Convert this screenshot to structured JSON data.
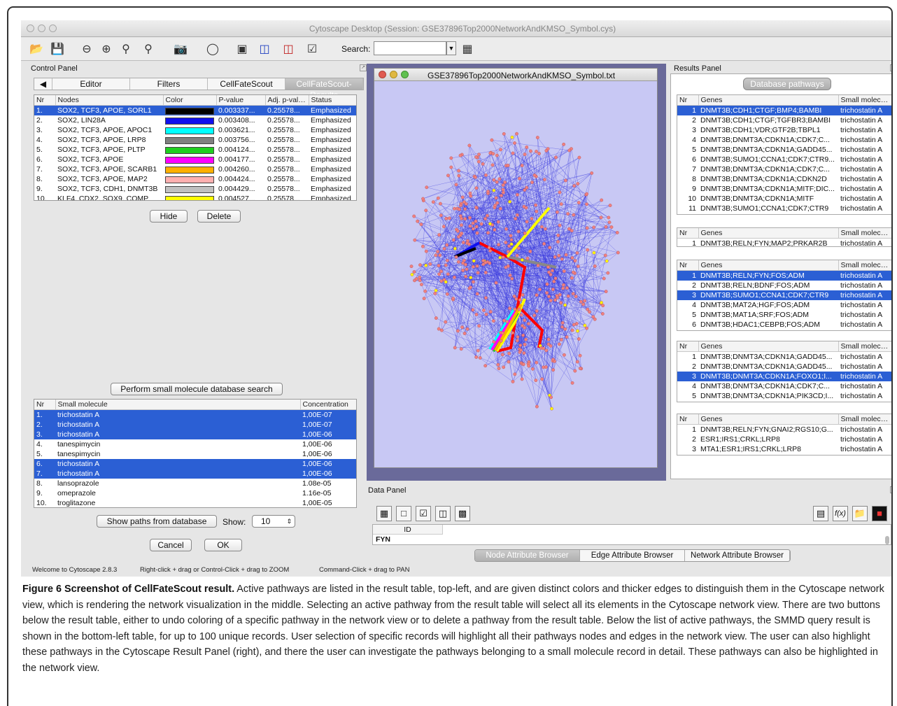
{
  "window": {
    "title": "Cytoscape Desktop (Session: GSE37896Top2000NetworkAndKMSO_Symbol.cys)"
  },
  "toolbar": {
    "search_label": "Search:",
    "search_value": ""
  },
  "control_panel": {
    "title": "Control Panel",
    "tabs": [
      "Editor",
      "Filters",
      "CellFateScout",
      "CellFateScout-Results"
    ],
    "active_tab": "CellFateScout-Results",
    "pathways_table": {
      "columns": [
        "Nr",
        "Nodes",
        "Color",
        "P-value",
        "Adj. p-value",
        "Status"
      ],
      "rows": [
        {
          "nr": "1.",
          "nodes": "SOX2, TCF3, APOE, SORL1",
          "color": "#000000",
          "p": "0.003337...",
          "adj": "0.25578...",
          "status": "Emphasized",
          "selected": true
        },
        {
          "nr": "2.",
          "nodes": "SOX2, LIN28A",
          "color": "#1010ee",
          "p": "0.003408...",
          "adj": "0.25578...",
          "status": "Emphasized",
          "selected": false
        },
        {
          "nr": "3.",
          "nodes": "SOX2, TCF3, APOE, APOC1",
          "color": "#00ffff",
          "p": "0.003621...",
          "adj": "0.25578...",
          "status": "Emphasized",
          "selected": false
        },
        {
          "nr": "4.",
          "nodes": "SOX2, TCF3, APOE, LRP8",
          "color": "#808080",
          "p": "0.003756...",
          "adj": "0.25578...",
          "status": "Emphasized",
          "selected": false
        },
        {
          "nr": "5.",
          "nodes": "SOX2, TCF3, APOE, PLTP",
          "color": "#1fcf1f",
          "p": "0.004124...",
          "adj": "0.25578...",
          "status": "Emphasized",
          "selected": false
        },
        {
          "nr": "6.",
          "nodes": "SOX2, TCF3, APOE",
          "color": "#ff00ff",
          "p": "0.004177...",
          "adj": "0.25578...",
          "status": "Emphasized",
          "selected": false
        },
        {
          "nr": "7.",
          "nodes": "SOX2, TCF3, APOE, SCARB1",
          "color": "#ffb000",
          "p": "0.004260...",
          "adj": "0.25578...",
          "status": "Emphasized",
          "selected": false
        },
        {
          "nr": "8.",
          "nodes": "SOX2, TCF3, APOE, MAP2",
          "color": "#ffb0b0",
          "p": "0.004424...",
          "adj": "0.25578...",
          "status": "Emphasized",
          "selected": false
        },
        {
          "nr": "9.",
          "nodes": "SOX2, TCF3, CDH1, DNMT3B",
          "color": "#c0c0c0",
          "p": "0.004429...",
          "adj": "0.25578...",
          "status": "Emphasized",
          "selected": false
        },
        {
          "nr": "10.",
          "nodes": "KLF4, CDX2, SOX9, COMP",
          "color": "#ffff00",
          "p": "0.004527...",
          "adj": "0.25578...",
          "status": "Emphasized",
          "selected": false
        }
      ]
    },
    "hide_label": "Hide",
    "delete_label": "Delete",
    "search_button": "Perform small molecule database search",
    "molecule_table": {
      "columns": [
        "Nr",
        "Small molecule",
        "Concentration"
      ],
      "rows": [
        {
          "nr": "1.",
          "name": "trichostatin A",
          "conc": "1,00E-07",
          "selected": true
        },
        {
          "nr": "2.",
          "name": "trichostatin A",
          "conc": "1,00E-07",
          "selected": true
        },
        {
          "nr": "3.",
          "name": "trichostatin A",
          "conc": "1,00E-06",
          "selected": true
        },
        {
          "nr": "4.",
          "name": "tanespimycin",
          "conc": "1,00E-06",
          "selected": false
        },
        {
          "nr": "5.",
          "name": "tanespimycin",
          "conc": "1,00E-06",
          "selected": false
        },
        {
          "nr": "6.",
          "name": "trichostatin A",
          "conc": "1,00E-06",
          "selected": true
        },
        {
          "nr": "7.",
          "name": "trichostatin A",
          "conc": "1,00E-06",
          "selected": true
        },
        {
          "nr": "8.",
          "name": "lansoprazole",
          "conc": "1.08e-05",
          "selected": false
        },
        {
          "nr": "9.",
          "name": "omeprazole",
          "conc": "1.16e-05",
          "selected": false
        },
        {
          "nr": "10.",
          "name": "troglitazone",
          "conc": "1,00E-05",
          "selected": false
        }
      ]
    },
    "show_paths_label": "Show paths from database",
    "show_label": "Show:",
    "show_value": "10",
    "cancel_label": "Cancel",
    "ok_label": "OK"
  },
  "network_window": {
    "title": "GSE37896Top2000NetworkAndKMSO_Symbol.txt"
  },
  "results_panel": {
    "title": "Results Panel",
    "db_button": "Database pathways",
    "col_nr": "Nr",
    "col_genes": "Genes",
    "col_small": "Small molecule",
    "groups": [
      {
        "rows": [
          {
            "nr": "1",
            "genes": "DNMT3B;CDH1;CTGF;BMP4;BAMBI",
            "mol": "trichostatin A",
            "selected": true
          },
          {
            "nr": "2",
            "genes": "DNMT3B;CDH1;CTGF;TGFBR3;BAMBI",
            "mol": "trichostatin A",
            "selected": false
          },
          {
            "nr": "3",
            "genes": "DNMT3B;CDH1;VDR;GTF2B;TBPL1",
            "mol": "trichostatin A",
            "selected": false
          },
          {
            "nr": "4",
            "genes": "DNMT3B;DNMT3A;CDKN1A;CDK7;C...",
            "mol": "trichostatin A",
            "selected": false
          },
          {
            "nr": "5",
            "genes": "DNMT3B;DNMT3A;CDKN1A;GADD45...",
            "mol": "trichostatin A",
            "selected": false
          },
          {
            "nr": "6",
            "genes": "DNMT3B;SUMO1;CCNA1;CDK7;CTR9...",
            "mol": "trichostatin A",
            "selected": false
          },
          {
            "nr": "7",
            "genes": "DNMT3B;DNMT3A;CDKN1A;CDK7;C...",
            "mol": "trichostatin A",
            "selected": false
          },
          {
            "nr": "8",
            "genes": "DNMT3B;DNMT3A;CDKN1A;CDKN2D",
            "mol": "trichostatin A",
            "selected": false
          },
          {
            "nr": "9",
            "genes": "DNMT3B;DNMT3A;CDKN1A;MITF;DIC...",
            "mol": "trichostatin A",
            "selected": false
          },
          {
            "nr": "10",
            "genes": "DNMT3B;DNMT3A;CDKN1A;MITF",
            "mol": "trichostatin A",
            "selected": false
          },
          {
            "nr": "11",
            "genes": "DNMT3B;SUMO1;CCNA1;CDK7;CTR9",
            "mol": "trichostatin A",
            "selected": false
          }
        ]
      },
      {
        "rows": [
          {
            "nr": "1",
            "genes": "DNMT3B;RELN;FYN;MAP2;PRKAR2B",
            "mol": "trichostatin A",
            "selected": false
          }
        ]
      },
      {
        "rows": [
          {
            "nr": "1",
            "genes": "DNMT3B;RELN;FYN;FOS;ADM",
            "mol": "trichostatin A",
            "selected": true
          },
          {
            "nr": "2",
            "genes": "DNMT3B;RELN;BDNF;FOS;ADM",
            "mol": "trichostatin A",
            "selected": false
          },
          {
            "nr": "3",
            "genes": "DNMT3B;SUMO1;CCNA1;CDK7;CTR9",
            "mol": "trichostatin A",
            "selected": true
          },
          {
            "nr": "4",
            "genes": "DNMT3B;MAT2A;HGF;FOS;ADM",
            "mol": "trichostatin A",
            "selected": false
          },
          {
            "nr": "5",
            "genes": "DNMT3B;MAT1A;SRF;FOS;ADM",
            "mol": "trichostatin A",
            "selected": false
          },
          {
            "nr": "6",
            "genes": "DNMT3B;HDAC1;CEBPB;FOS;ADM",
            "mol": "trichostatin A",
            "selected": false
          }
        ]
      },
      {
        "rows": [
          {
            "nr": "1",
            "genes": "DNMT3B;DNMT3A;CDKN1A;GADD45...",
            "mol": "trichostatin A",
            "selected": false
          },
          {
            "nr": "2",
            "genes": "DNMT3B;DNMT3A;CDKN1A;GADD45...",
            "mol": "trichostatin A",
            "selected": false
          },
          {
            "nr": "3",
            "genes": "DNMT3B;DNMT3A;CDKN1A;FOXO1;I...",
            "mol": "trichostatin A",
            "selected": true
          },
          {
            "nr": "4",
            "genes": "DNMT3B;DNMT3A;CDKN1A;CDK7;C...",
            "mol": "trichostatin A",
            "selected": false
          },
          {
            "nr": "5",
            "genes": "DNMT3B;DNMT3A;CDKN1A;PIK3CD;I...",
            "mol": "trichostatin A",
            "selected": false
          }
        ]
      },
      {
        "rows": [
          {
            "nr": "1",
            "genes": "DNMT3B;RELN;FYN;GNAI2;RGS10;G...",
            "mol": "trichostatin A",
            "selected": false
          },
          {
            "nr": "2",
            "genes": "ESR1;IRS1;CRKL;LRP8",
            "mol": "trichostatin A",
            "selected": false
          },
          {
            "nr": "3",
            "genes": "MTA1;ESR1;IRS1;CRKL;LRP8",
            "mol": "trichostatin A",
            "selected": false
          }
        ]
      }
    ]
  },
  "data_panel": {
    "title": "Data Panel",
    "col_id": "ID",
    "row_value": "FYN",
    "tabs": [
      "Node Attribute Browser",
      "Edge Attribute Browser",
      "Network Attribute Browser"
    ],
    "active_tab": "Node Attribute Browser"
  },
  "status_bar": {
    "welcome": "Welcome to Cytoscape 2.8.3",
    "zoom_hint": "Right-click + drag or Control-Click + drag to ZOOM",
    "pan_hint": "Command-Click + drag to PAN"
  },
  "caption": {
    "title": "Figure 6 Screenshot of CellFateScout result.",
    "text": "Active pathways are listed in the result table, top-left, and are given distinct colors and thicker edges to distinguish them in the Cytoscape network view, which is rendering the network visualization in the middle. Selecting an active pathway from the result table will select all its elements in the Cytoscape network view. There are two buttons below the result table, either to undo coloring of a specific pathway in the network view or to delete a pathway from the result table. Below the list of active pathways, the SMMD query result is shown in the bottom-left table, for up to 100 unique records. User selection of specific records will highlight all their pathways nodes and edges in the network view. The user can also highlight these pathways in the Cytoscape Result Panel (right), and there the user can investigate the pathways belonging to a small molecule record in detail. These pathways can also be highlighted in the network view."
  },
  "icons": [
    "open-folder-icon",
    "save-icon",
    "zoom-out-icon",
    "zoom-in-icon",
    "zoom-fit-icon",
    "zoom-selected-icon",
    "camera-icon",
    "help-icon",
    "layout-icon",
    "select-first-neighbors-icon",
    "select-edges-icon",
    "filter-icon",
    "search-options-icon",
    "table-icon",
    "new-icon",
    "checklist-icon",
    "columns-icon",
    "trash-icon",
    "notes-icon",
    "function-icon",
    "folder-icon",
    "heatmap-icon"
  ]
}
